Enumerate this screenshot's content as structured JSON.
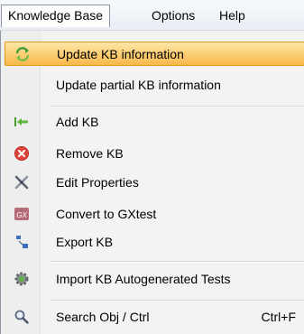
{
  "menubar": {
    "items": [
      {
        "label": "Knowledge Base"
      },
      {
        "label": "Options"
      },
      {
        "label": "Help"
      }
    ]
  },
  "dropdown": {
    "items": [
      {
        "label": "Update KB information",
        "icon": "refresh-arrows-icon"
      },
      {
        "label": "Update partial KB information",
        "icon": ""
      },
      {
        "label": "Add KB",
        "icon": "add-kb-arrow-icon"
      },
      {
        "label": "Remove KB",
        "icon": "remove-red-x-icon"
      },
      {
        "label": "Edit Properties",
        "icon": "tools-icon"
      },
      {
        "label": "Convert to GXtest",
        "icon": "gx-badge-icon"
      },
      {
        "label": "Export KB",
        "icon": "export-icon"
      },
      {
        "label": "Import KB Autogenerated Tests",
        "icon": "gear-icon"
      },
      {
        "label": "Search Obj / Ctrl",
        "icon": "search-icon",
        "shortcut": "Ctrl+F"
      }
    ]
  },
  "colors": {
    "highlight_top": "#fde7a6",
    "highlight_bottom": "#f9b74a",
    "remove_red": "#e0413a",
    "add_green": "#4c9a2a"
  }
}
